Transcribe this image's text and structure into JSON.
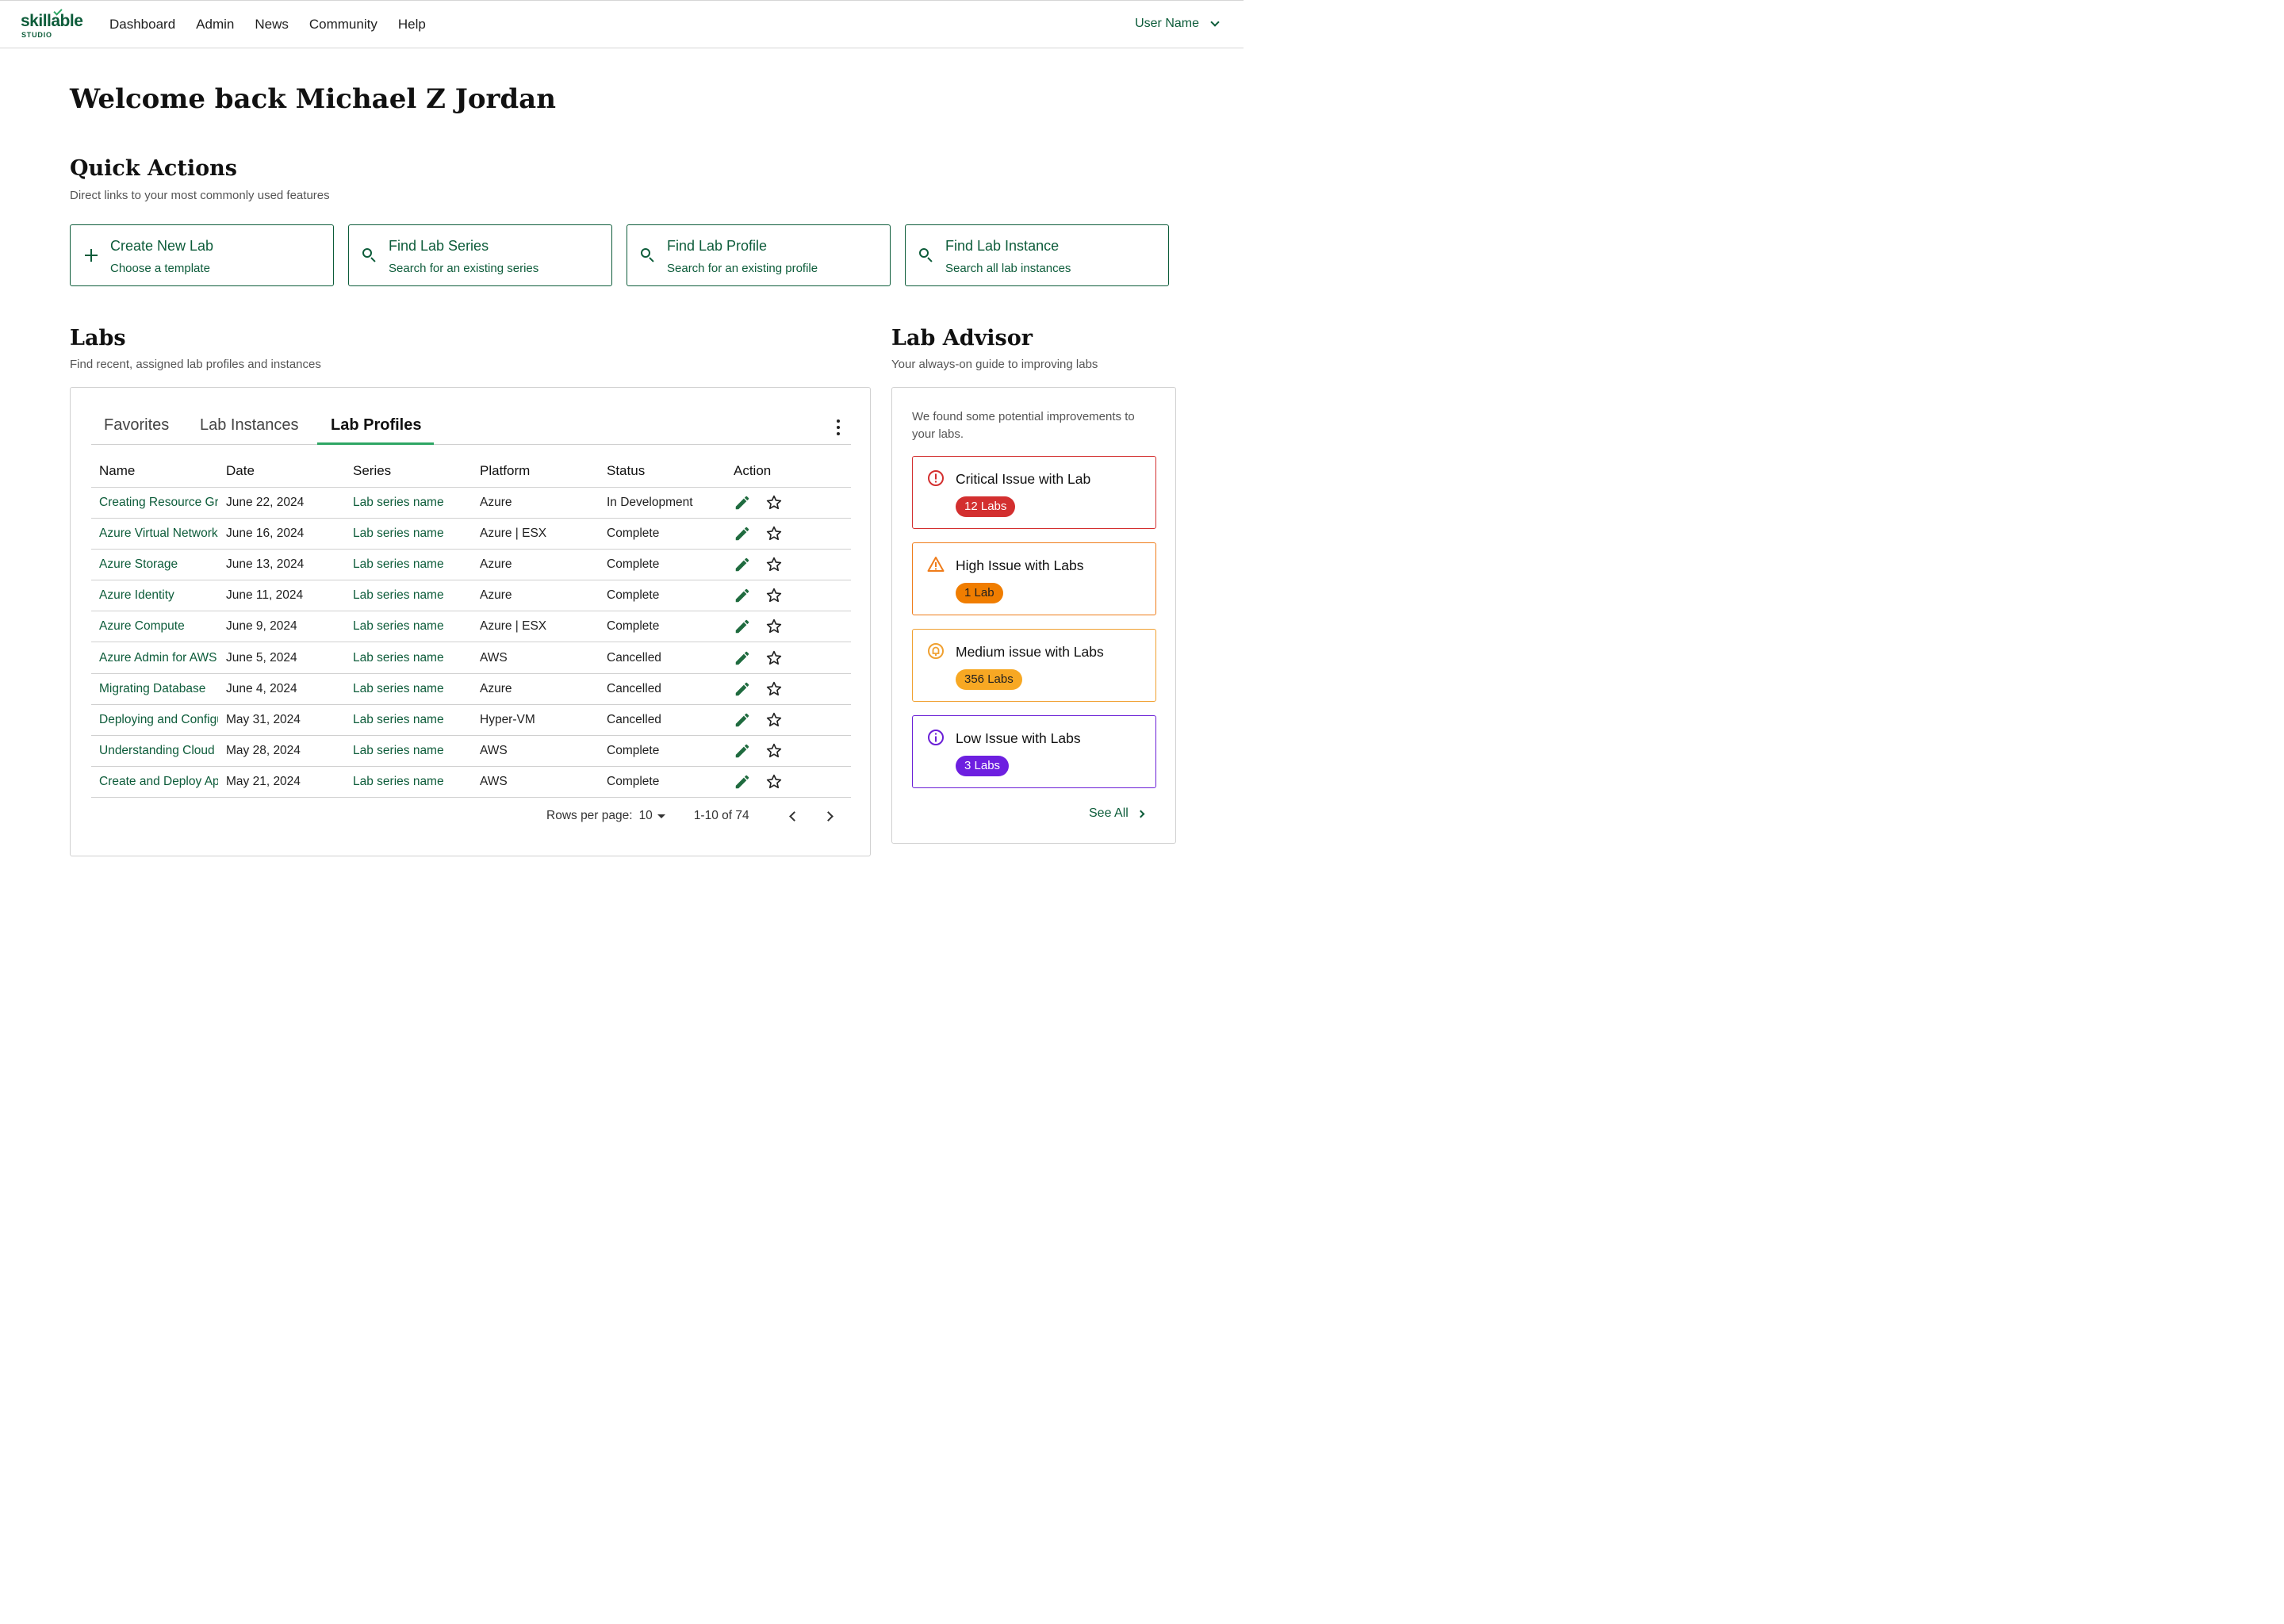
{
  "brand": {
    "name": "skillable",
    "sub": "STUDIO"
  },
  "nav": {
    "links": [
      "Dashboard",
      "Admin",
      "News",
      "Community",
      "Help"
    ],
    "user": "User Name"
  },
  "welcome": "Welcome back Michael Z Jordan",
  "quick_actions": {
    "title": "Quick Actions",
    "subtitle": "Direct links to your most commonly used features",
    "cards": [
      {
        "title": "Create New Lab",
        "desc": "Choose a template",
        "icon": "plus-icon"
      },
      {
        "title": "Find Lab Series",
        "desc": "Search for an existing series",
        "icon": "search-icon"
      },
      {
        "title": "Find Lab Profile",
        "desc": "Search for an existing profile",
        "icon": "search-icon"
      },
      {
        "title": "Find Lab Instance",
        "desc": "Search all lab instances",
        "icon": "search-icon"
      }
    ]
  },
  "labs": {
    "title": "Labs",
    "subtitle": "Find recent, assigned lab profiles and instances",
    "tabs": [
      "Favorites",
      "Lab Instances",
      "Lab Profiles"
    ],
    "active_tab": "Lab Profiles",
    "columns": [
      "Name",
      "Date",
      "Series",
      "Platform",
      "Status",
      "Action"
    ],
    "rows": [
      {
        "name": "Creating Resource Groups",
        "date": "June 22, 2024",
        "series": "Lab series name",
        "platform": "Azure",
        "status": "In Development"
      },
      {
        "name": "Azure Virtual Networks",
        "date": "June 16, 2024",
        "series": "Lab series name",
        "platform": "Azure | ESX",
        "status": "Complete"
      },
      {
        "name": "Azure Storage",
        "date": "June 13, 2024",
        "series": "Lab series name",
        "platform": "Azure",
        "status": "Complete"
      },
      {
        "name": "Azure Identity",
        "date": "June 11, 2024",
        "series": "Lab series name",
        "platform": "Azure",
        "status": "Complete"
      },
      {
        "name": "Azure Compute",
        "date": "June 9, 2024",
        "series": "Lab series name",
        "platform": "Azure | ESX",
        "status": "Complete"
      },
      {
        "name": "Azure Admin for AWS",
        "date": "June 5, 2024",
        "series": "Lab series name",
        "platform": "AWS",
        "status": "Cancelled"
      },
      {
        "name": "Migrating Database",
        "date": "June 4, 2024",
        "series": "Lab series name",
        "platform": "Azure",
        "status": "Cancelled"
      },
      {
        "name": "Deploying and Configuring",
        "date": "May 31, 2024",
        "series": "Lab series name",
        "platform": "Hyper-VM",
        "status": "Cancelled"
      },
      {
        "name": "Understanding Cloud",
        "date": "May 28, 2024",
        "series": "Lab series name",
        "platform": "AWS",
        "status": "Complete"
      },
      {
        "name": "Create and Deploy Apps",
        "date": "May 21, 2024",
        "series": "Lab series name",
        "platform": "AWS",
        "status": "Complete"
      }
    ],
    "pagination": {
      "rows_label": "Rows per page:",
      "rows_value": "10",
      "range": "1-10 of 74"
    }
  },
  "advisor": {
    "title": "Lab Advisor",
    "subtitle": "Your always-on guide to improving labs",
    "intro": "We found some potential improvements to your labs.",
    "issues": [
      {
        "title": "Critical Issue with Lab",
        "badge": "12 Labs",
        "icon": "alert-circle-icon",
        "border": "#d32f2f",
        "badge_bg": "#d32f2f",
        "badge_fg": "#ffffff"
      },
      {
        "title": "High Issue with Labs",
        "badge": "1 Lab",
        "icon": "warning-triangle-icon",
        "border": "#ef7c1a",
        "badge_bg": "#f07d00",
        "badge_fg": "#1f1f1f"
      },
      {
        "title": "Medium issue with Labs",
        "badge": "356 Labs",
        "icon": "bell-circle-icon",
        "border": "#f0a030",
        "badge_bg": "#f7a823",
        "badge_fg": "#1f1f1f"
      },
      {
        "title": "Low Issue with Labs",
        "badge": "3 Labs",
        "icon": "info-circle-icon",
        "border": "#6a1fd6",
        "badge_bg": "#6d1fe0",
        "badge_fg": "#ffffff"
      }
    ],
    "see_all": "See All"
  }
}
